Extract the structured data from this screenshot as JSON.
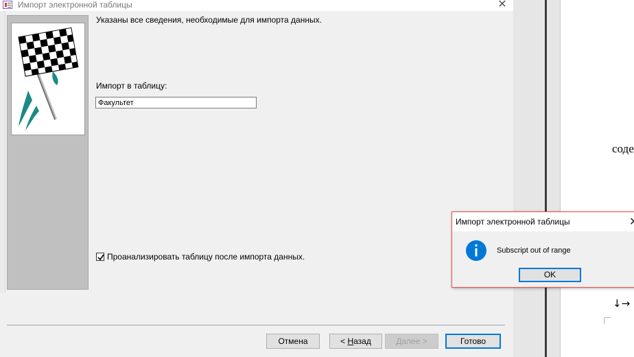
{
  "wizard": {
    "title": "Импорт электронной таблицы",
    "info_text": "Указаны все сведения, необходимые для импорта данных.",
    "import_label": "Импорт в таблицу:",
    "import_value": "Факультет",
    "analyze_checked": true,
    "analyze_label": "Проанализировать таблицу после импорта данных.",
    "buttons": {
      "cancel": "Отмена",
      "back_prefix": "< ",
      "back_underlined": "Н",
      "back_rest": "азад",
      "next_underlined": "Д",
      "next_rest": "алее >",
      "finish": "Готово"
    }
  },
  "document": {
    "visible_text": "соде",
    "arrows": "↓→"
  },
  "message_box": {
    "title": "Импорт электронной таблицы",
    "icon": "info-icon",
    "message": "Subscript out of range",
    "ok_label": "OK"
  },
  "colors": {
    "info_blue": "#0078d7",
    "flag_teal": "#1a8a86",
    "error_border": "#e0554b"
  }
}
